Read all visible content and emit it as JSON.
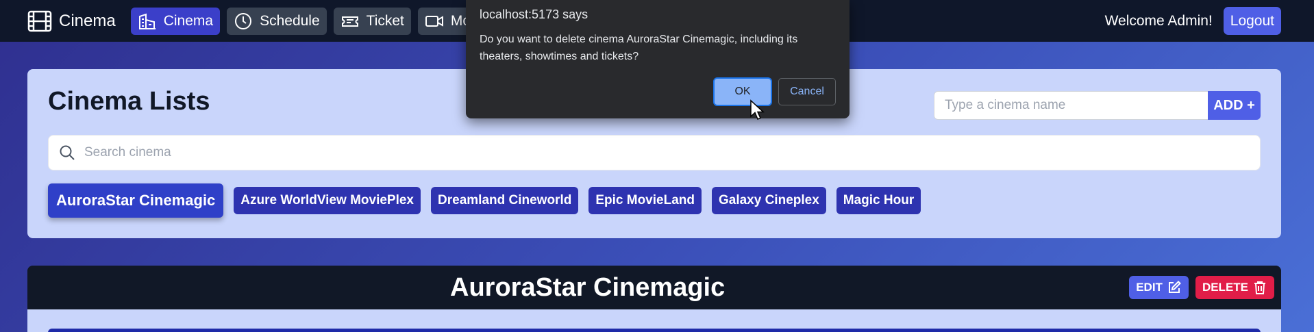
{
  "nav": {
    "brand_label": "Cinema",
    "items": [
      {
        "label": "Cinema",
        "icon": "building-icon",
        "active": true
      },
      {
        "label": "Schedule",
        "icon": "clock-icon",
        "active": false
      },
      {
        "label": "Ticket",
        "icon": "ticket-icon",
        "active": false
      },
      {
        "label": "Mo",
        "icon": "video-icon",
        "active": false
      }
    ],
    "welcome": "Welcome Admin!",
    "logout_label": "Logout"
  },
  "cinema_list": {
    "title": "Cinema Lists",
    "add_placeholder": "Type a cinema name",
    "add_label": "ADD +",
    "search_placeholder": "Search cinema",
    "cinemas": [
      "AuroraStar Cinemagic",
      "Azure WorldView MoviePlex",
      "Dreamland Cineworld",
      "Epic MovieLand",
      "Galaxy Cineplex",
      "Magic Hour"
    ],
    "selected": "AuroraStar Cinemagic"
  },
  "detail": {
    "title": "AuroraStar Cinemagic",
    "edit_label": "EDIT",
    "delete_label": "DELETE"
  },
  "dialog": {
    "title": "localhost:5173 says",
    "message": "Do you want to delete cinema AuroraStar Cinemagic, including its theaters, showtimes and tickets?",
    "ok_label": "OK",
    "cancel_label": "Cancel"
  },
  "colors": {
    "nav_bg": "#0f172a",
    "accent": "#4f5fe6",
    "chip": "#2e33b0",
    "danger": "#e11d48",
    "card_bg": "#c9d5fb"
  }
}
